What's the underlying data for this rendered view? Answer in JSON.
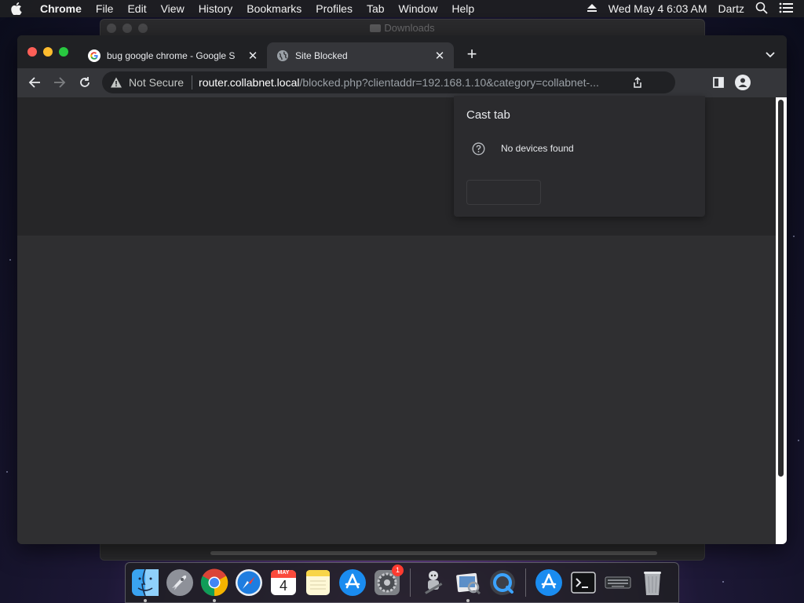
{
  "menubar": {
    "app_name": "Chrome",
    "items": [
      "File",
      "Edit",
      "View",
      "History",
      "Bookmarks",
      "Profiles",
      "Tab",
      "Window",
      "Help"
    ],
    "datetime": "Wed May 4  6:03 AM",
    "user": "Dartz"
  },
  "background_window": {
    "title": "Downloads"
  },
  "chrome": {
    "tabs": [
      {
        "title": "bug google chrome - Google S",
        "active": false
      },
      {
        "title": "Site Blocked",
        "active": true
      }
    ],
    "omnibox": {
      "security_label": "Not Secure",
      "host": "router.collabnet.local",
      "path": "/blocked.php?clientaddr=192.168.1.10&category=collabnet-..."
    },
    "cast_popup": {
      "title": "Cast tab",
      "status": "No devices found"
    }
  },
  "dock": {
    "apps": [
      "finder-icon",
      "launchpad-icon",
      "chrome-icon",
      "safari-icon",
      "calendar-icon",
      "notes-icon",
      "app-store-icon",
      "system-preferences-icon",
      "automator-icon",
      "preview-icon",
      "quicktime-icon",
      "app-store-icon",
      "terminal-icon",
      "keyboard-icon",
      "trash-icon"
    ],
    "calendar_month": "MAY",
    "calendar_day": "4",
    "system_prefs_badge": "1"
  },
  "colors": {
    "traffic_red": "#fe5f57",
    "traffic_yellow": "#febc2e",
    "traffic_green": "#28c840",
    "toolbar": "#35363a",
    "tabstrip": "#202124"
  }
}
